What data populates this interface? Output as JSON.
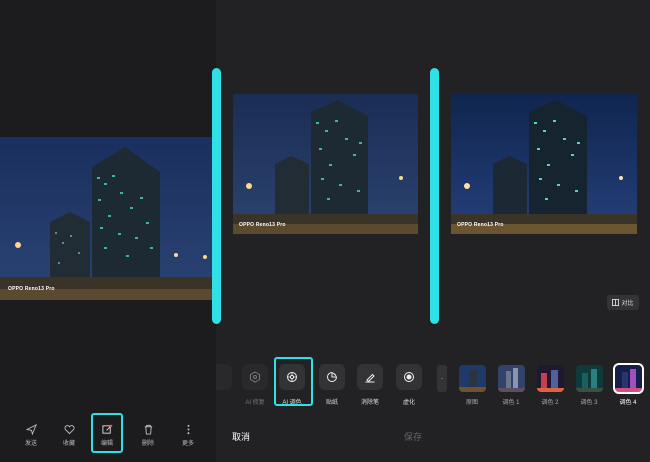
{
  "left_panel": {
    "top_text": "",
    "watermark": "OPPO Reno13 Pro",
    "bottom_bar": [
      {
        "label": "发送",
        "icon": "send-icon"
      },
      {
        "label": "收藏",
        "icon": "heart-icon"
      },
      {
        "label": "编辑",
        "icon": "edit-icon"
      },
      {
        "label": "删除",
        "icon": "trash-icon"
      },
      {
        "label": "更多",
        "icon": "more-icon"
      }
    ]
  },
  "mid_panel": {
    "watermark": "OPPO Reno13 Pro",
    "tools": [
      {
        "label": "",
        "icon": "partial-tool-icon"
      },
      {
        "label": "AI 修复",
        "icon": "ai-repair-icon"
      },
      {
        "label": "AI 调色",
        "icon": "ai-color-icon"
      },
      {
        "label": "贴纸",
        "icon": "sticker-icon"
      },
      {
        "label": "消除笔",
        "icon": "eraser-icon"
      },
      {
        "label": "虚化",
        "icon": "blur-icon"
      }
    ],
    "cancel_label": "取消",
    "save_label": "保存"
  },
  "right_panel": {
    "watermark": "OPPO Reno13 Pro",
    "compare_label": "对比",
    "filters": [
      {
        "label": "原图"
      },
      {
        "label": "调色 1"
      },
      {
        "label": "调色 2"
      },
      {
        "label": "调色 3"
      },
      {
        "label": "调色 4"
      }
    ],
    "selected_filter": "调色 4"
  },
  "colors": {
    "accent": "#2fe0e6",
    "background": "#1c1c1e"
  }
}
